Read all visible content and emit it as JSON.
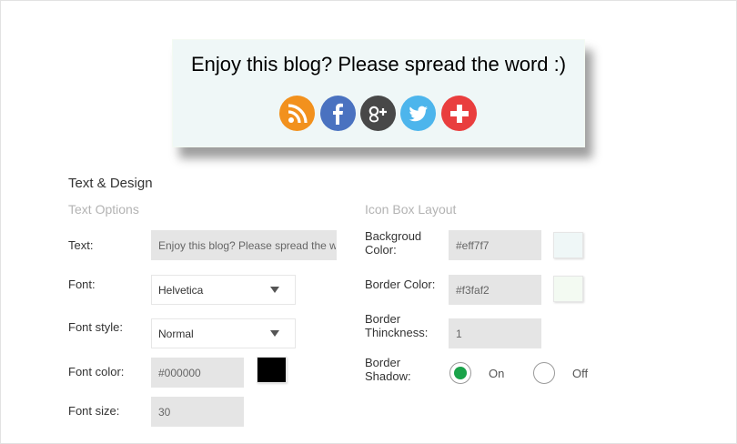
{
  "preview": {
    "title": "Enjoy this blog? Please spread the word :)",
    "background_color": "#eff7f7",
    "border_color": "#f3faf2",
    "icons": [
      {
        "name": "rss-icon",
        "color": "#f2911d"
      },
      {
        "name": "facebook-icon",
        "color": "#4a72c0"
      },
      {
        "name": "google-plus-icon",
        "color": "#484848"
      },
      {
        "name": "twitter-icon",
        "color": "#4db5ec"
      },
      {
        "name": "add-more-icon",
        "color": "#e93e3e"
      }
    ]
  },
  "settings": {
    "section_title": "Text & Design",
    "text_options": {
      "title": "Text Options",
      "text_label": "Text:",
      "text_value": "Enjoy this blog? Please spread the word :)",
      "font_label": "Font:",
      "font_value": "Helvetica",
      "font_style_label": "Font style:",
      "font_style_value": "Normal",
      "font_color_label": "Font color:",
      "font_color_value": "#000000",
      "font_size_label": "Font size:",
      "font_size_value": "30"
    },
    "icon_box_layout": {
      "title": "Icon Box Layout",
      "background_color_label_line1": "Backgroud",
      "background_color_label_line2": "Color:",
      "background_color_value": "#eff7f7",
      "border_color_label": "Border Color:",
      "border_color_value": "#f3faf2",
      "border_thickness_label_line1": "Border",
      "border_thickness_label_line2": "Thinckness:",
      "border_thickness_value": "1",
      "border_shadow_label_line1": "Border",
      "border_shadow_label_line2": "Shadow:",
      "shadow_on_label": "On",
      "shadow_off_label": "Off",
      "shadow_selected": "On"
    }
  }
}
